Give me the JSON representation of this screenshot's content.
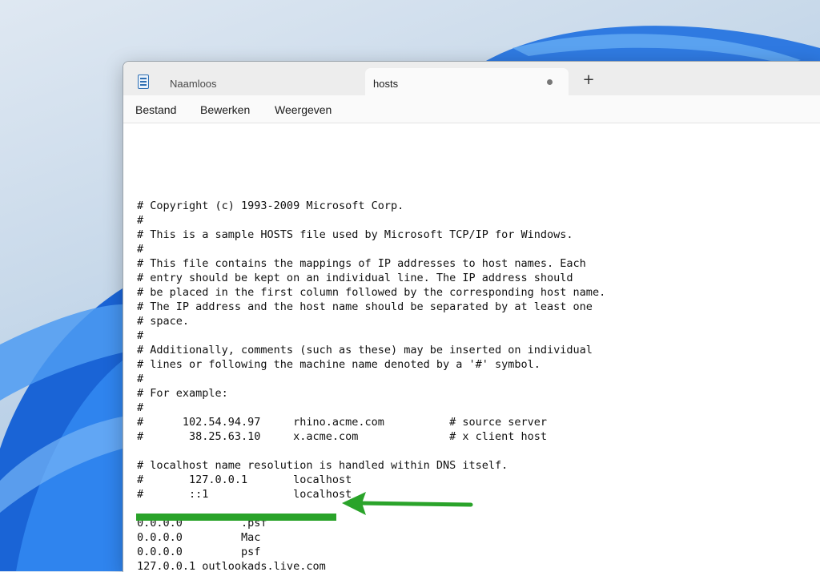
{
  "tabs": [
    {
      "label": "Naamloos",
      "active": false
    },
    {
      "label": "hosts",
      "active": true,
      "unsaved": true
    }
  ],
  "menu": [
    "Bestand",
    "Bewerken",
    "Weergeven"
  ],
  "editor": {
    "lines": [
      "# Copyright (c) 1993-2009 Microsoft Corp.",
      "#",
      "# This is a sample HOSTS file used by Microsoft TCP/IP for Windows.",
      "#",
      "# This file contains the mappings of IP addresses to host names. Each",
      "# entry should be kept on an individual line. The IP address should",
      "# be placed in the first column followed by the corresponding host name.",
      "# The IP address and the host name should be separated by at least one",
      "# space.",
      "#",
      "# Additionally, comments (such as these) may be inserted on individual",
      "# lines or following the machine name denoted by a '#' symbol.",
      "#",
      "# For example:",
      "#",
      "#      102.54.94.97     rhino.acme.com          # source server",
      "#       38.25.63.10     x.acme.com              # x client host",
      "",
      "# localhost name resolution is handled within DNS itself.",
      "#       127.0.0.1       localhost",
      "#       ::1             localhost",
      "",
      "0.0.0.0         .psf",
      "0.0.0.0         Mac",
      "0.0.0.0         psf",
      "127.0.0.1 outlookads.live.com"
    ]
  },
  "annotation": {
    "color": "#2aa32a"
  },
  "icons": {
    "app": "notepad-icon",
    "add_tab": "plus-icon",
    "unsaved": "unsaved-dot-icon"
  }
}
